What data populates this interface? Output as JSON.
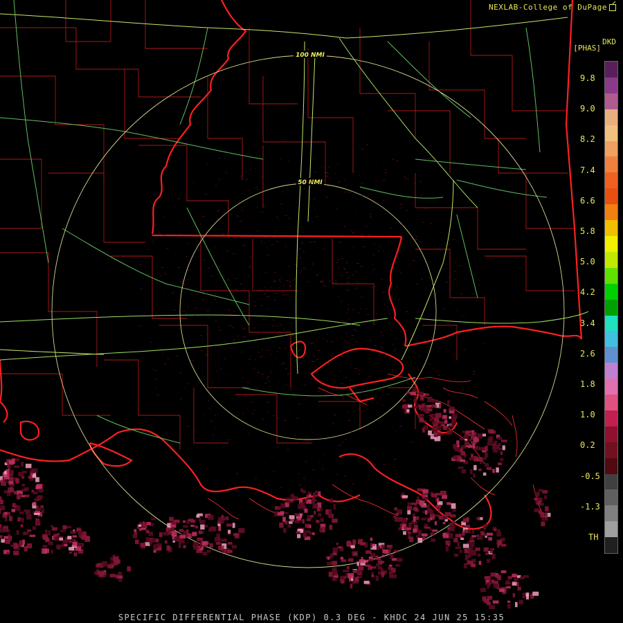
{
  "header": {
    "credit": "NEXLAB-College of DuPage",
    "credit_icon": "external-link-icon"
  },
  "legend": {
    "product": "DKD",
    "unit": "[PHAS]",
    "labels": [
      "9.8",
      "9.0",
      "8.2",
      "7.4",
      "6.6",
      "5.8",
      "5.0",
      "4.2",
      "3.4",
      "2.6",
      "1.8",
      "1.0",
      "0.2",
      "-0.5",
      "-1.3",
      "TH"
    ],
    "colors": [
      "#5a1f5a",
      "#8a3a8a",
      "#b05a90",
      "#e8b080",
      "#f0c080",
      "#f0a060",
      "#f08040",
      "#f06020",
      "#e85010",
      "#f08010",
      "#f0c000",
      "#f0f000",
      "#c0e800",
      "#60e000",
      "#00d000",
      "#00a000",
      "#20e0c0",
      "#40c0e0",
      "#6090d0",
      "#c080d0",
      "#e070b0",
      "#e05080",
      "#c02050",
      "#901030",
      "#701020",
      "#500a10",
      "#404040",
      "#606060",
      "#808080",
      "#a0a0a0",
      "#202020"
    ]
  },
  "map": {
    "range_rings": [
      "50 NMI",
      "100 NMI"
    ],
    "radar_site": "KHDC"
  },
  "footer": {
    "caption": "SPECIFIC DIFFERENTIAL PHASE (KDP) 0.3 DEG - KHDC 24 JUN 25 15:35"
  }
}
